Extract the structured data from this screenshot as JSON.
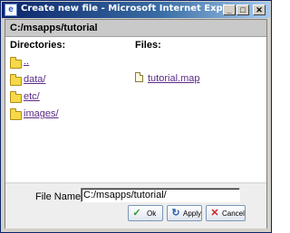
{
  "window": {
    "title": "Create new file - Microsoft Internet Explorer"
  },
  "titlebar_buttons": {
    "minimize": "_",
    "maximize": "□",
    "close": "✕"
  },
  "path": "C:/msapps/tutorial",
  "headers": {
    "directories": "Directories:",
    "files": "Files:"
  },
  "directories": [
    {
      "name": ".."
    },
    {
      "name": "data/"
    },
    {
      "name": "etc/"
    },
    {
      "name": "images/"
    }
  ],
  "files": [
    {
      "name": "tutorial.map"
    }
  ],
  "filename": {
    "label": "File Name:",
    "value": "C:/msapps/tutorial/"
  },
  "buttons": {
    "ok": "Ok",
    "apply": "Apply",
    "cancel": "Cancel"
  },
  "icons": {
    "ok": "check-icon",
    "apply": "refresh-icon",
    "cancel": "x-icon",
    "folder": "folder-icon",
    "file": "file-icon"
  }
}
